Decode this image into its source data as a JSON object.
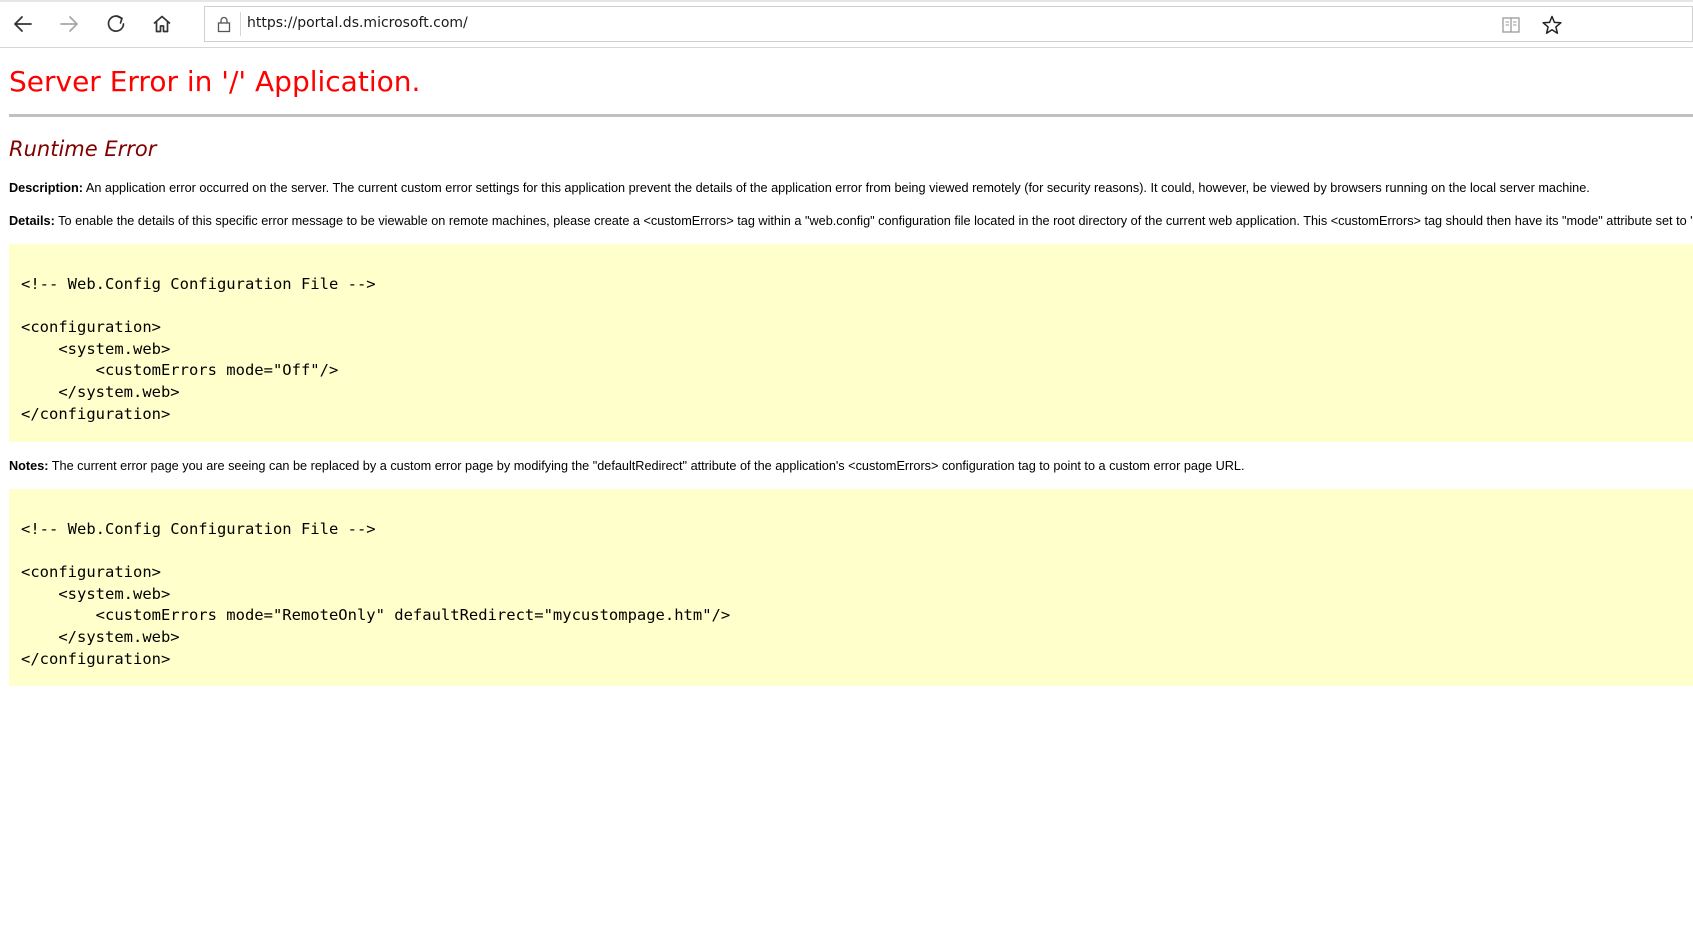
{
  "browser": {
    "url_prefix": "https://",
    "url_host": "portal.ds.microsoft.com/",
    "back_icon": "back-arrow",
    "forward_icon": "forward-arrow",
    "refresh_icon": "refresh",
    "home_icon": "home",
    "lock_icon": "lock",
    "reading_view_icon": "book",
    "favorite_icon": "star"
  },
  "page": {
    "title": "Server Error in '/' Application.",
    "subtitle": "Runtime Error",
    "description_label": "Description:",
    "description_text": " An application error occurred on the server. The current custom error settings for this application prevent the details of the application error from being viewed remotely (for security reasons). It could, however, be viewed by browsers running on the local server machine.",
    "details_label": "Details:",
    "details_text": " To enable the details of this specific error message to be viewable on remote machines, please create a <customErrors> tag within a \"web.config\" configuration file located in the root directory of the current web application. This <customErrors> tag should then have its \"mode\" attribute set to \"Off\".",
    "code1": [
      "<!-- Web.Config Configuration File -->",
      "",
      "<configuration>",
      "    <system.web>",
      "        <customErrors mode=\"Off\"/>",
      "    </system.web>",
      "</configuration>"
    ],
    "notes_label": "Notes:",
    "notes_text": " The current error page you are seeing can be replaced by a custom error page by modifying the \"defaultRedirect\" attribute of the application's <customErrors> configuration tag to point to a custom error page URL.",
    "code2": [
      "<!-- Web.Config Configuration File -->",
      "",
      "<configuration>",
      "    <system.web>",
      "        <customErrors mode=\"RemoteOnly\" defaultRedirect=\"mycustompage.htm\"/>",
      "    </system.web>",
      "</configuration>"
    ]
  },
  "colors": {
    "title": "#ff0000",
    "subtitle": "#800000",
    "code_background": "#ffffcc",
    "rule": "#c0c0c0"
  }
}
